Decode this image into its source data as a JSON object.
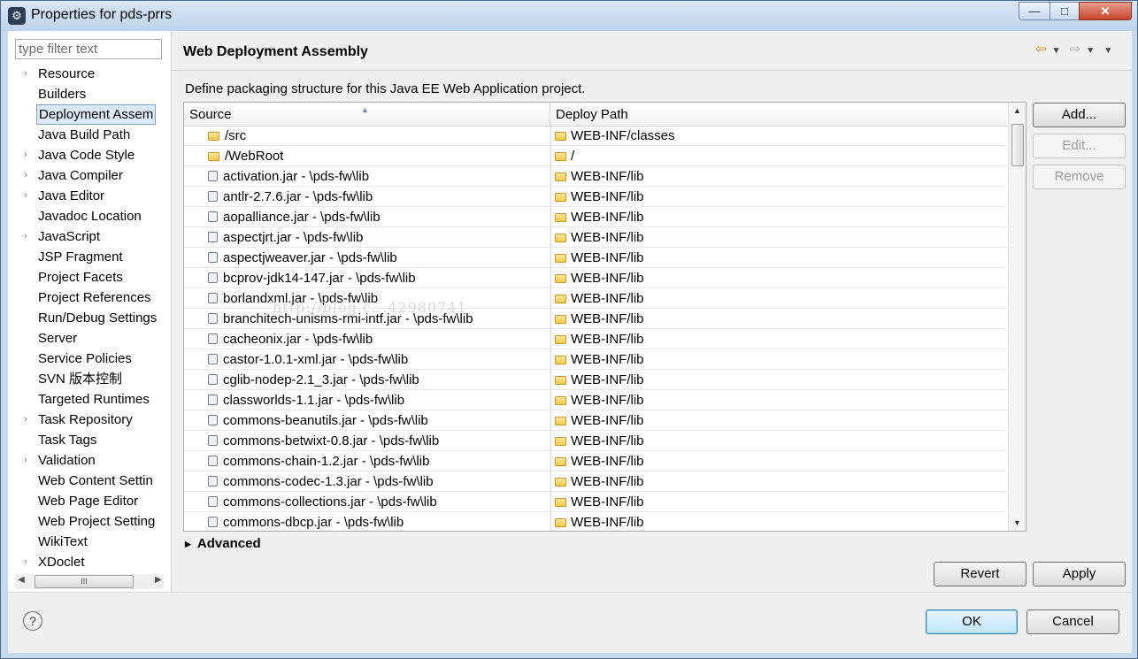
{
  "window": {
    "title": "Properties for pds-prrs",
    "app_icon": "eclipse-gear-icon",
    "controls": {
      "minimize": "—",
      "maximize": "□",
      "close": "✕"
    }
  },
  "sidebar": {
    "filter_placeholder": "type filter text",
    "items": [
      {
        "label": "Resource",
        "expandable": true
      },
      {
        "label": "Builders",
        "expandable": false
      },
      {
        "label": "Deployment Assem",
        "expandable": false,
        "selected": true
      },
      {
        "label": "Java Build Path",
        "expandable": false
      },
      {
        "label": "Java Code Style",
        "expandable": true
      },
      {
        "label": "Java Compiler",
        "expandable": true
      },
      {
        "label": "Java Editor",
        "expandable": true
      },
      {
        "label": "Javadoc Location",
        "expandable": false
      },
      {
        "label": "JavaScript",
        "expandable": true
      },
      {
        "label": "JSP Fragment",
        "expandable": false
      },
      {
        "label": "Project Facets",
        "expandable": false
      },
      {
        "label": "Project References",
        "expandable": false
      },
      {
        "label": "Run/Debug Settings",
        "expandable": false
      },
      {
        "label": "Server",
        "expandable": false
      },
      {
        "label": "Service Policies",
        "expandable": false
      },
      {
        "label": "SVN 版本控制",
        "expandable": false
      },
      {
        "label": "Targeted Runtimes",
        "expandable": false
      },
      {
        "label": "Task Repository",
        "expandable": true
      },
      {
        "label": "Task Tags",
        "expandable": false
      },
      {
        "label": "Validation",
        "expandable": true
      },
      {
        "label": "Web Content Settin",
        "expandable": false
      },
      {
        "label": "Web Page Editor",
        "expandable": false
      },
      {
        "label": "Web Project Setting",
        "expandable": false
      },
      {
        "label": "WikiText",
        "expandable": false
      },
      {
        "label": "XDoclet",
        "expandable": true
      }
    ],
    "scroll_thumb_label": "III"
  },
  "main": {
    "title": "Web Deployment Assembly",
    "nav": {
      "back": "⇦",
      "back_menu": "▼",
      "forward": "⇨",
      "forward_menu": "▼",
      "view_menu": "▼"
    },
    "description": "Define packaging structure for this Java EE Web Application project.",
    "table": {
      "columns": {
        "source": "Source",
        "deploy": "Deploy Path"
      },
      "sort_indicator": "▲",
      "rows": [
        {
          "source": "/src",
          "src_icon": "folder",
          "deploy": "WEB-INF/classes"
        },
        {
          "source": "/WebRoot",
          "src_icon": "folder",
          "deploy": "/"
        },
        {
          "source": "activation.jar - \\pds-fw\\lib",
          "src_icon": "jar",
          "deploy": "WEB-INF/lib"
        },
        {
          "source": "antlr-2.7.6.jar - \\pds-fw\\lib",
          "src_icon": "jar",
          "deploy": "WEB-INF/lib"
        },
        {
          "source": "aopalliance.jar - \\pds-fw\\lib",
          "src_icon": "jar",
          "deploy": "WEB-INF/lib"
        },
        {
          "source": "aspectjrt.jar - \\pds-fw\\lib",
          "src_icon": "jar",
          "deploy": "WEB-INF/lib"
        },
        {
          "source": "aspectjweaver.jar - \\pds-fw\\lib",
          "src_icon": "jar",
          "deploy": "WEB-INF/lib"
        },
        {
          "source": "bcprov-jdk14-147.jar - \\pds-fw\\lib",
          "src_icon": "jar",
          "deploy": "WEB-INF/lib"
        },
        {
          "source": "borlandxml.jar - \\pds-fw\\lib",
          "src_icon": "jar",
          "deploy": "WEB-INF/lib"
        },
        {
          "source": "branchitech-unisms-rmi-intf.jar - \\pds-fw\\lib",
          "src_icon": "jar",
          "deploy": "WEB-INF/lib"
        },
        {
          "source": "cacheonix.jar - \\pds-fw\\lib",
          "src_icon": "jar",
          "deploy": "WEB-INF/lib"
        },
        {
          "source": "castor-1.0.1-xml.jar - \\pds-fw\\lib",
          "src_icon": "jar",
          "deploy": "WEB-INF/lib"
        },
        {
          "source": "cglib-nodep-2.1_3.jar - \\pds-fw\\lib",
          "src_icon": "jar",
          "deploy": "WEB-INF/lib"
        },
        {
          "source": "classworlds-1.1.jar - \\pds-fw\\lib",
          "src_icon": "jar",
          "deploy": "WEB-INF/lib"
        },
        {
          "source": "commons-beanutils.jar - \\pds-fw\\lib",
          "src_icon": "jar",
          "deploy": "WEB-INF/lib"
        },
        {
          "source": "commons-betwixt-0.8.jar - \\pds-fw\\lib",
          "src_icon": "jar",
          "deploy": "WEB-INF/lib"
        },
        {
          "source": "commons-chain-1.2.jar - \\pds-fw\\lib",
          "src_icon": "jar",
          "deploy": "WEB-INF/lib"
        },
        {
          "source": "commons-codec-1.3.jar - \\pds-fw\\lib",
          "src_icon": "jar",
          "deploy": "WEB-INF/lib"
        },
        {
          "source": "commons-collections.jar - \\pds-fw\\lib",
          "src_icon": "jar",
          "deploy": "WEB-INF/lib"
        },
        {
          "source": "commons-dbcp.jar - \\pds-fw\\lib",
          "src_icon": "jar",
          "deploy": "WEB-INF/lib"
        }
      ]
    },
    "buttons": {
      "add": "Add...",
      "edit": "Edit...",
      "remove": "Remove"
    },
    "advanced_label": "Advanced",
    "revert_label": "Revert",
    "apply_label": "Apply",
    "watermark": "http://blog.c...42980741"
  },
  "footer": {
    "help": "?",
    "ok": "OK",
    "cancel": "Cancel"
  }
}
